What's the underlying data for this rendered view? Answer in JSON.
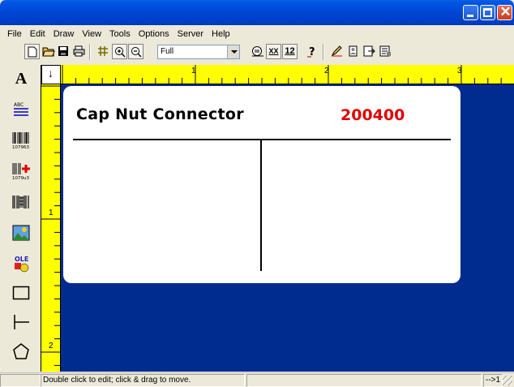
{
  "window": {
    "title": ""
  },
  "menu": [
    "File",
    "Edit",
    "Draw",
    "View",
    "Tools",
    "Options",
    "Server",
    "Help"
  ],
  "toolbar": {
    "zoom_value": "Full",
    "text_12": "12",
    "text_xx": "XX"
  },
  "palette": {
    "text_tool_letter": "A",
    "barcode_label": "ABC",
    "barcode_number": "107963",
    "rfid_number": "1079u3",
    "ole_label": "OLE"
  },
  "rulers": {
    "h_numbers": [
      "1",
      "2",
      "3"
    ],
    "v_numbers": [
      "1",
      "2"
    ]
  },
  "label": {
    "product_name": "Cap Nut Connector",
    "part_number": "200400",
    "part_number_color": "#e00000"
  },
  "statusbar": {
    "hint": "Double click to edit; click & drag to move.",
    "right": "-->1"
  },
  "colors": {
    "canvas": "#002b8f",
    "ruler": "#ffff00",
    "titlebar": "#0046d4"
  }
}
